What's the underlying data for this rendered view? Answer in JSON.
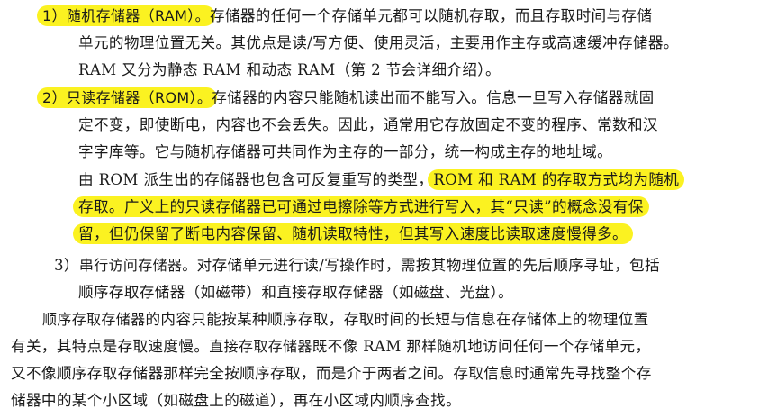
{
  "item1": {
    "title": "1）随机存储器（RAM）。",
    "line1_rest": "存储器的任何一个存储单元都可以随机存取，而且存取时间与存储",
    "line2": "单元的物理位置无关。其优点是读/写方便、使用灵活，主要用作主存或高速缓冲存储器。",
    "line3": "RAM 又分为静态 RAM 和动态 RAM（第 2 节会详细介绍）。"
  },
  "item2": {
    "title": "2）只读存储器（ROM）。",
    "line1_rest": "存储器的内容只能随机读出而不能写入。信息一旦写入存储器就固",
    "line2": "定不变，即使断电，内容也不会丢失。因此，通常用它存放固定不变的程序、常数和汉",
    "line3": "字字库等。它与随机存储器可共同作为主存的一部分，统一构成主存的地址域。",
    "para2_plain": "由 ROM 派生出的存储器也包含可反复重写的类型，",
    "para2_hl_a": "ROM 和 RAM 的存取方式均为随机",
    "para2_hl_b": "存取。广义上的只读存储器已可通过电擦除等方式进行写入，其“只读”的概念没有保",
    "para2_hl_c": "留，但仍保留了断电内容保留、随机读取特性，但其写入速度比读取速度慢得多。"
  },
  "item3": {
    "number": "3）",
    "title": "串行访问存储器。",
    "line1_rest": "对存储单元进行读/写操作时，需按其物理位置的先后顺序寻址，包括",
    "line2": "顺序存取存储器（如磁带）和直接存取存储器（如磁盘、光盘）。"
  },
  "para": {
    "term1": "顺序存取存储器",
    "text1": "的内容只能按某种顺序存取，存取时间的长短与信息在存储体上的物理位置",
    "line2_a": "有关，其特点是存取速度慢。",
    "term2": "直接存取存储器",
    "line2_b": "既不像 RAM 那样随机地访问任何一个存储单元，",
    "line3": "又不像顺序存取存储器那样完全按顺序存取，而是介于两者之间。存取信息时通常先寻找整个存",
    "line4": "储器中的某个小区域（如磁盘上的磁道），再在小区域内顺序查找。"
  },
  "colors": {
    "highlight": "#fbf221",
    "text": "#1a1a1a"
  }
}
